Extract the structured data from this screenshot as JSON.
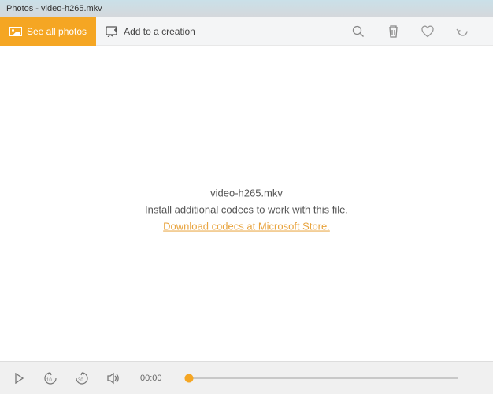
{
  "titlebar": {
    "title": "Photos - video-h265.mkv"
  },
  "toolbar": {
    "see_all_label": "See all photos",
    "add_label": "Add to a creation"
  },
  "message": {
    "filename": "video-h265.mkv",
    "instruction": "Install additional codecs to work with this file.",
    "link_text": "Download codecs at Microsoft Store."
  },
  "player": {
    "time": "00:00",
    "progress_percent": 0
  },
  "icons": {
    "zoom": "zoom-icon",
    "delete": "delete-icon",
    "favorite": "favorite-icon",
    "rotate": "rotate-icon",
    "play": "play-icon",
    "skip_back_10": "skip-back-10-icon",
    "skip_fwd_30": "skip-forward-30-icon",
    "volume": "volume-icon",
    "add_creation": "add-creation-icon"
  }
}
